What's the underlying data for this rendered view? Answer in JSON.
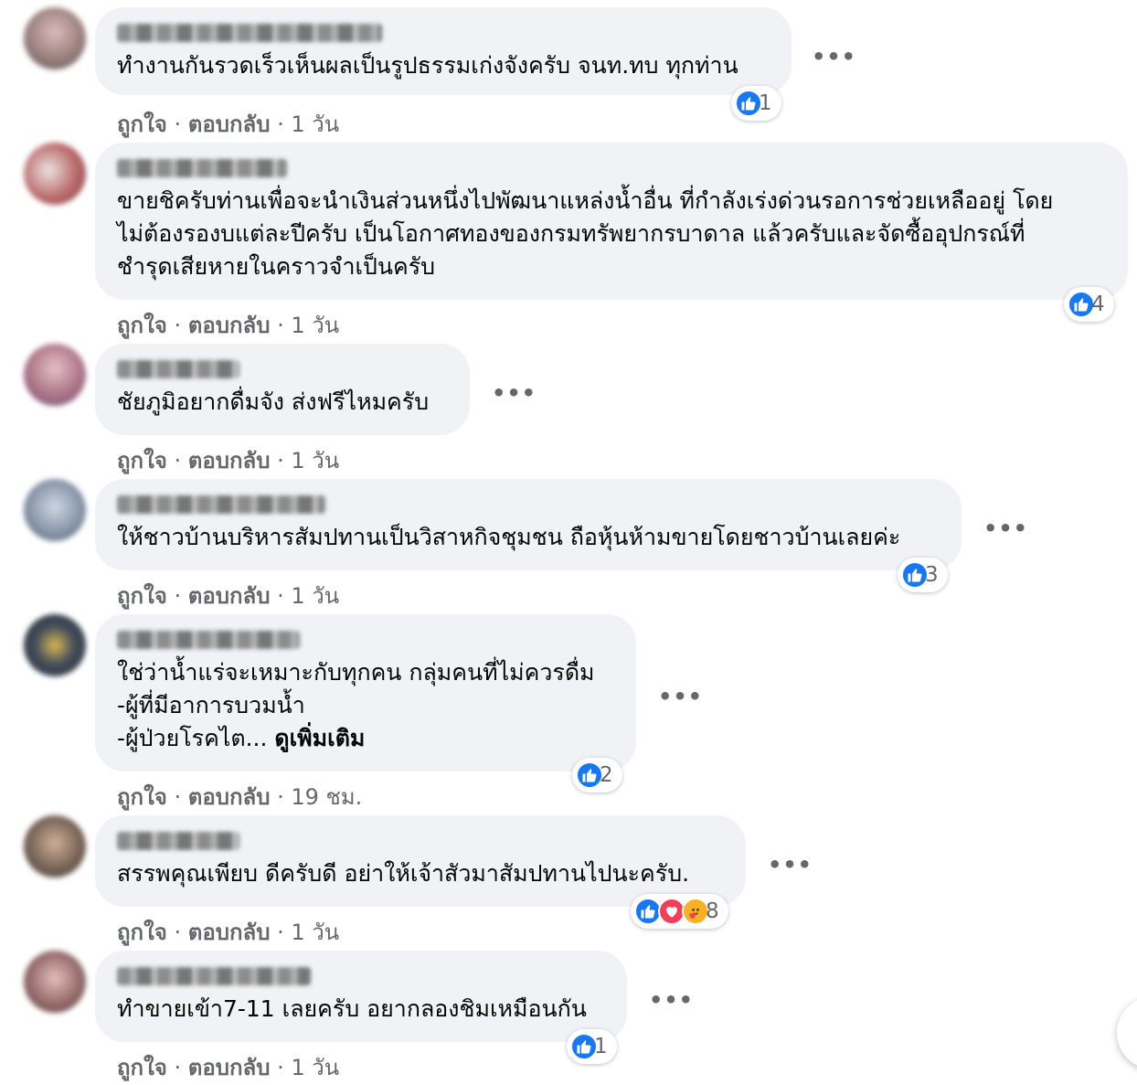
{
  "comments": [
    {
      "text": "ทำงานกันรวดเร็วเห็นผลเป็นรูปธรรมเก่งจังครับ จนท.ทบ ทุกท่าน",
      "like": "ถูกใจ",
      "reply": "ตอบกลับ",
      "time": "1 วัน",
      "reaction_count": "1",
      "reactions": [
        "like"
      ],
      "avatar_color": "#8a6e6a"
    },
    {
      "text": "ขายชิครับท่านเพื่อจะนำเงินส่วนหนึ่งไปพัฒนาแหล่งน้ำอื่น ที่กำลังเร่งด่วนรอการช่วยเหลืออยู่ โดย\nไม่ต้องรองบแต่ละปีครับ เป็นโอกาศทองของกรมทรัพยากรบาดาล แล้วครับและจัดซื้ออุปกรณ์ที่\nชำรุดเสียหายในคราวจำเป็นครับ",
      "like": "ถูกใจ",
      "reply": "ตอบกลับ",
      "time": "1 วัน",
      "reaction_count": "4",
      "reactions": [
        "like"
      ],
      "avatar_color": "#b45a5a"
    },
    {
      "text": "ชัยภูมิอยากดื่มจัง ส่งฟรีไหมครับ",
      "like": "ถูกใจ",
      "reply": "ตอบกลับ",
      "time": "1 วัน",
      "reaction_count": "",
      "reactions": [],
      "avatar_color": "#a4667a"
    },
    {
      "text": "ให้ชาวบ้านบริหารสัมปทานเป็นวิสาหกิจชุมชน ถือหุ้นห้ามขายโดยชาวบ้านเลยค่ะ",
      "like": "ถูกใจ",
      "reply": "ตอบกลับ",
      "time": "1 วัน",
      "reaction_count": "3",
      "reactions": [
        "like"
      ],
      "avatar_color": "#7d8ca0"
    },
    {
      "text": "ใช่ว่าน้ำแร่จะเหมาะกับทุกคน กลุ่มคนที่ไม่ควรดื่ม\n-ผู้ที่มีอาการบวมน้ำ\n-ผู้ป่วยโรคไต...",
      "more": "ดูเพิ่มเติม",
      "like": "ถูกใจ",
      "reply": "ตอบกลับ",
      "time": "19 ชม.",
      "reaction_count": "2",
      "reactions": [
        "like"
      ],
      "avatar_color": "#2f3a4a"
    },
    {
      "text": "สรรพคุณเพียบ ดีครับดี อย่าให้เจ้าสัวมาสัมปทานไปนะครับ.",
      "like": "ถูกใจ",
      "reply": "ตอบกลับ",
      "time": "1 วัน",
      "reaction_count": "8",
      "reactions": [
        "like",
        "love",
        "care"
      ],
      "avatar_color": "#6a5446"
    },
    {
      "text": "ทำขายเข้า7-11 เลยครับ อยากลองชิมเหมือนกัน",
      "like": "ถูกใจ",
      "reply": "ตอบกลับ",
      "time": "1 วัน",
      "reaction_count": "1",
      "reactions": [
        "like"
      ],
      "avatar_color": "#8c5c5c"
    }
  ],
  "icons": {
    "more": "more-options-icon",
    "like": "thumbs-up-icon",
    "love": "heart-icon",
    "care": "care-face-icon"
  },
  "colors": {
    "bubble": "#f0f2f5",
    "meta": "#65676b",
    "like": "#1877f2",
    "love": "#f33e58",
    "care": "#f7b125"
  },
  "more_dots": "•••"
}
